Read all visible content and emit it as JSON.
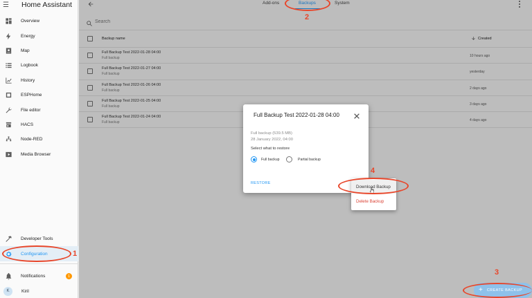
{
  "app": {
    "title": "Home Assistant"
  },
  "sidebar": {
    "items": [
      {
        "label": "Overview",
        "icon": "overview-icon"
      },
      {
        "label": "Energy",
        "icon": "energy-icon"
      },
      {
        "label": "Map",
        "icon": "map-icon"
      },
      {
        "label": "Logbook",
        "icon": "logbook-icon"
      },
      {
        "label": "History",
        "icon": "history-icon"
      },
      {
        "label": "ESPHome",
        "icon": "esphome-icon"
      },
      {
        "label": "File editor",
        "icon": "wrench-icon"
      },
      {
        "label": "HACS",
        "icon": "hacs-icon"
      },
      {
        "label": "Node-RED",
        "icon": "node-red-icon"
      },
      {
        "label": "Media Browser",
        "icon": "media-browser-icon"
      }
    ],
    "developer_tools": "Developer Tools",
    "configuration": "Configuration",
    "notifications": "Notifications",
    "notifications_count": "1",
    "user_initial": "K",
    "user_name": "Kiril"
  },
  "header": {
    "tabs": [
      {
        "label": "Add-ons"
      },
      {
        "label": "Backups"
      },
      {
        "label": "System"
      }
    ],
    "active_tab": "Backups"
  },
  "search": {
    "placeholder": "Search"
  },
  "table": {
    "columns": {
      "name": "Backup name",
      "created": "Created"
    },
    "rows": [
      {
        "name": "Full Backup Test 2022-01-28 04:00",
        "type": "Full backup",
        "created": "10 hours ago"
      },
      {
        "name": "Full Backup Test 2022-01-27 04:00",
        "type": "Full backup",
        "created": "yesterday"
      },
      {
        "name": "Full Backup Test 2022-01-26 04:00",
        "type": "Full backup",
        "created": "2 days ago"
      },
      {
        "name": "Full Backup Test 2022-01-25 04:00",
        "type": "Full backup",
        "created": "3 days ago"
      },
      {
        "name": "Full Backup Test 2022-01-24 04:00",
        "type": "Full backup",
        "created": "4 days ago"
      }
    ]
  },
  "dialog": {
    "title": "Full Backup Test 2022-01-28 04:00",
    "size_line": "Full backup (539.5 MB)",
    "date_line": "28 January 2022, 04:00",
    "select_label": "Select what to restore",
    "option_full": "Full backup",
    "option_partial": "Partial backup",
    "selected_option": "Full backup",
    "restore_label": "RESTORE"
  },
  "menu": {
    "download": "Download Backup",
    "delete": "Delete Backup"
  },
  "fab": {
    "label": "CREATE BACKUP"
  },
  "annotations": {
    "n1": "1",
    "n2": "2",
    "n3": "3",
    "n4": "4"
  },
  "colors": {
    "accent": "#2196f3",
    "annotation": "#e8462a",
    "danger": "#db4437",
    "badge": "#ff9800"
  }
}
